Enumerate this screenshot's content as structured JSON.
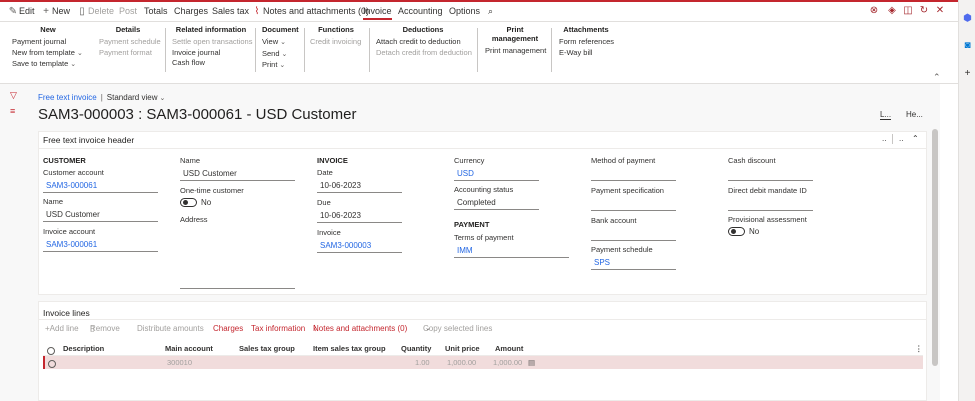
{
  "topbar": {
    "edit": "Edit",
    "new": "New",
    "delete": "Delete",
    "post": "Post",
    "totals": "Totals",
    "charges": "Charges",
    "sales_tax": "Sales tax",
    "notes": "Notes and attachments (0)",
    "invoice": "Invoice",
    "accounting": "Accounting",
    "options": "Options"
  },
  "ribbon": {
    "new": {
      "title": "New",
      "items": [
        "Payment journal",
        "New from template",
        "Save to template"
      ]
    },
    "details": {
      "title": "Details",
      "items": [
        "Payment schedule",
        "Payment format"
      ]
    },
    "related": {
      "title": "Related information",
      "items": [
        "Settle open transactions",
        "Invoice journal",
        "Cash flow"
      ]
    },
    "document": {
      "title": "Document",
      "items": [
        "View",
        "Send",
        "Print"
      ]
    },
    "functions": {
      "title": "Functions",
      "items": [
        "Credit invoicing"
      ]
    },
    "deductions": {
      "title": "Deductions",
      "items": [
        "Attach credit to deduction",
        "Detach credit from deduction"
      ]
    },
    "printmgmt": {
      "title": "Print management",
      "items": [
        "Print management"
      ]
    },
    "attachments": {
      "title": "Attachments",
      "items": [
        "Form references",
        "E-Way bill"
      ]
    }
  },
  "breadcrumb": {
    "link": "Free text invoice",
    "view": "Standard view"
  },
  "page_title": "SAM3-000003 : SAM3-000061 - USD Customer",
  "title_actions": {
    "a": "L...",
    "b": "He..."
  },
  "header_card": {
    "title": "Free text invoice header",
    "ctrl_a": "..",
    "ctrl_b": "..",
    "customer": {
      "section": "CUSTOMER",
      "customer_account_label": "Customer account",
      "customer_account": "SAM3-000061",
      "name_label": "Name",
      "name": "USD Customer",
      "invoice_account_label": "Invoice account",
      "invoice_account": "SAM3-000061"
    },
    "col2": {
      "name_label": "Name",
      "name": "USD Customer",
      "one_time_label": "One-time customer",
      "one_time": "No",
      "address_label": "Address",
      "address": ""
    },
    "invoice": {
      "section": "INVOICE",
      "date_label": "Date",
      "date": "10-06-2023",
      "due_label": "Due",
      "due": "10-06-2023",
      "invoice_label": "Invoice",
      "invoice": "SAM3-000003"
    },
    "col4": {
      "currency_label": "Currency",
      "currency": "USD",
      "acct_status_label": "Accounting status",
      "acct_status": "Completed",
      "payment_section": "PAYMENT",
      "terms_label": "Terms of payment",
      "terms": "IMM"
    },
    "col5": {
      "method_label": "Method of payment",
      "method": "",
      "spec_label": "Payment specification",
      "spec": "",
      "bank_label": "Bank account",
      "bank": "",
      "schedule_label": "Payment schedule",
      "schedule": "SPS"
    },
    "col6": {
      "cash_discount_label": "Cash discount",
      "cash_discount": "",
      "direct_debit_label": "Direct debit mandate ID",
      "direct_debit": "",
      "provisional_label": "Provisional assessment",
      "provisional": "No"
    }
  },
  "lines_card": {
    "title": "Invoice lines",
    "toolbar": {
      "add_line": "Add line",
      "remove": "Remove",
      "distribute": "Distribute amounts",
      "charges": "Charges",
      "tax_info": "Tax information",
      "notes": "Notes and attachments (0)",
      "copy": "Copy selected lines"
    },
    "columns": [
      "Description",
      "Main account",
      "Sales tax group",
      "Item sales tax group",
      "Quantity",
      "Unit price",
      "Amount"
    ],
    "rows": [
      {
        "description": "",
        "main_account": "300010",
        "sales_tax_group": "",
        "item_sales_tax_group": "",
        "quantity": "1.00",
        "unit_price": "1,000.00",
        "amount": "1,000.00"
      }
    ]
  },
  "colors": {
    "accent": "#c4262e",
    "link": "#2266e3",
    "row_highlight": "#f1dcdc"
  }
}
